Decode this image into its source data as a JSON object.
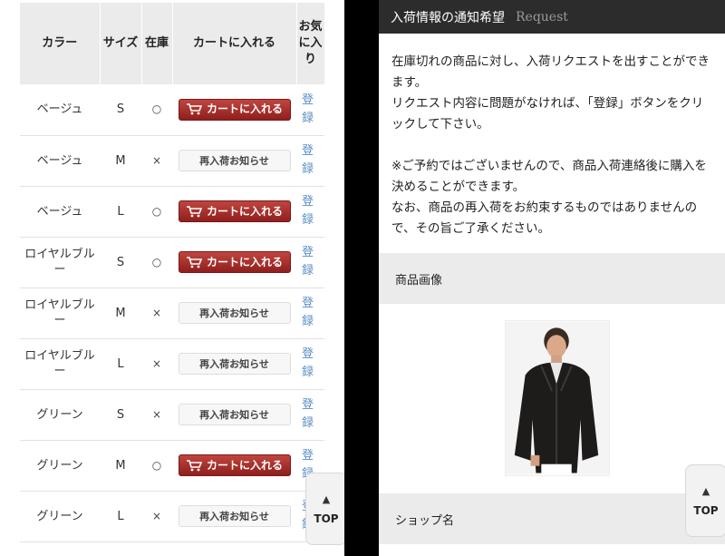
{
  "table": {
    "headers": {
      "color": "カラー",
      "size": "サイズ",
      "stock": "在庫",
      "cart": "カートに入れる",
      "wish": "お気に入り"
    },
    "rows": [
      {
        "color": "ベージュ",
        "size": "S",
        "stock": "○",
        "action": "カートに入れる",
        "action_type": "cart",
        "register": "登録"
      },
      {
        "color": "ベージュ",
        "size": "M",
        "stock": "×",
        "action": "再入荷お知らせ",
        "action_type": "notify",
        "register": "登録"
      },
      {
        "color": "ベージュ",
        "size": "L",
        "stock": "○",
        "action": "カートに入れる",
        "action_type": "cart",
        "register": "登録"
      },
      {
        "color": "ロイヤルブルー",
        "size": "S",
        "stock": "○",
        "action": "カートに入れる",
        "action_type": "cart",
        "register": "登録"
      },
      {
        "color": "ロイヤルブルー",
        "size": "M",
        "stock": "×",
        "action": "再入荷お知らせ",
        "action_type": "notify",
        "register": "登録"
      },
      {
        "color": "ロイヤルブルー",
        "size": "L",
        "stock": "×",
        "action": "再入荷お知らせ",
        "action_type": "notify",
        "register": "登録"
      },
      {
        "color": "グリーン",
        "size": "S",
        "stock": "×",
        "action": "再入荷お知らせ",
        "action_type": "notify",
        "register": "登録"
      },
      {
        "color": "グリーン",
        "size": "M",
        "stock": "○",
        "action": "カートに入れる",
        "action_type": "cart",
        "register": "登録"
      },
      {
        "color": "グリーン",
        "size": "L",
        "stock": "×",
        "action": "再入荷お知らせ",
        "action_type": "notify",
        "register": "登録"
      }
    ]
  },
  "top_button": {
    "arrow": "▲",
    "label": "TOP"
  },
  "notify_panel": {
    "title": "入荷情報の通知希望",
    "subtitle": "Request",
    "paragraph1": "在庫切れの商品に対し、入荷リクエストを出すことができます。",
    "paragraph2": "リクエスト内容に問題がなければ、「登録」ボタンをクリックして下さい。",
    "paragraph3": "※ご予約ではございませんので、商品入荷連絡後に購入を決めることができます。",
    "paragraph4": "なお、商品の再入荷をお約束するものではありませんので、その旨ご了承ください。",
    "section_image": "商品画像",
    "section_shop": "ショップ名"
  },
  "colors": {
    "cart_button": "#a8302c",
    "link": "#5a8ec6",
    "header_bar": "#2c2c2c",
    "section_bg": "#ebebeb"
  }
}
